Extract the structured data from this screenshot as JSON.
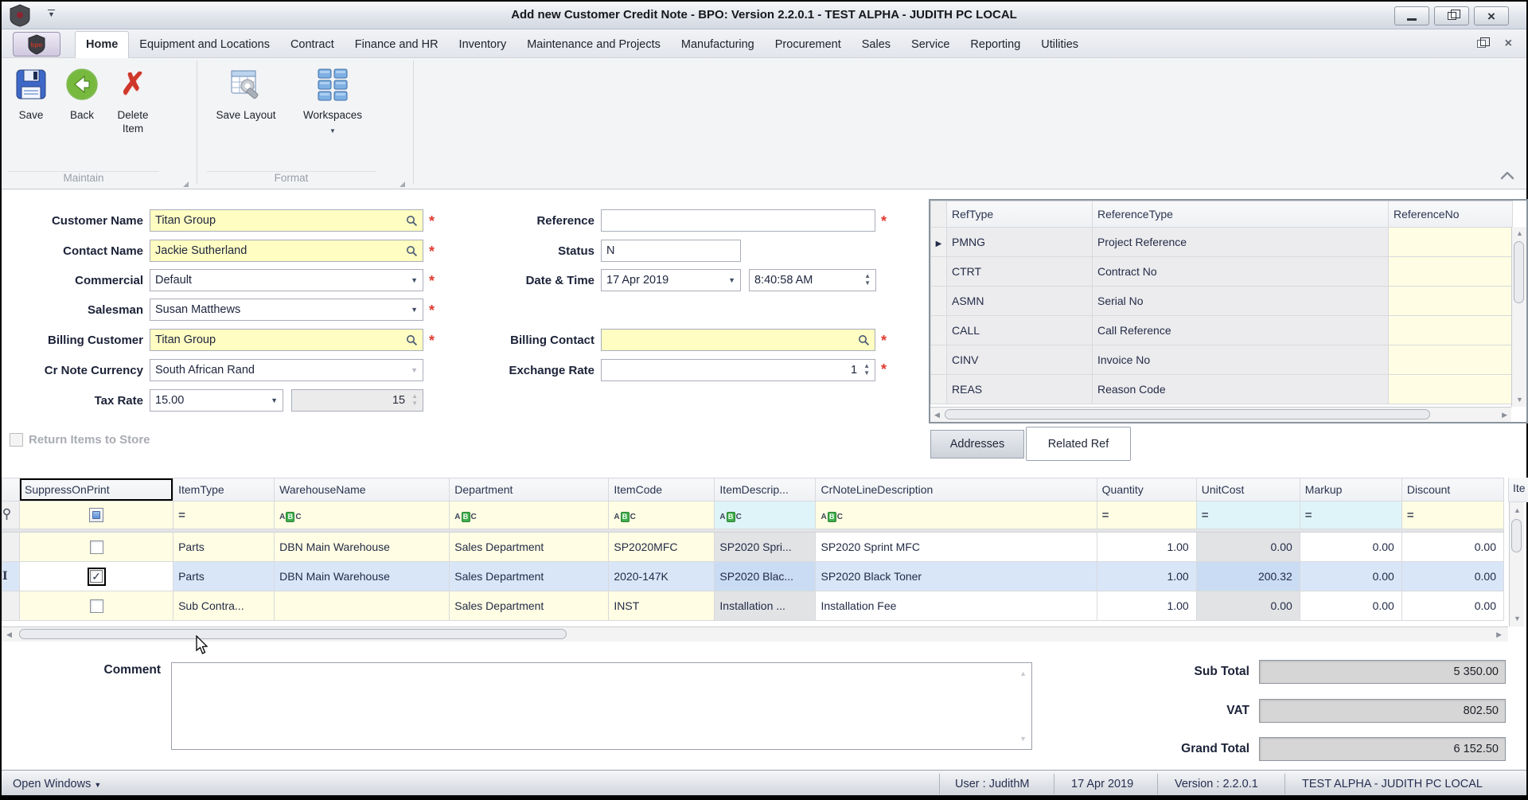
{
  "window": {
    "title": "Add new Customer Credit Note - BPO: Version 2.2.0.1 - TEST ALPHA - JUDITH PC LOCAL"
  },
  "ribbon": {
    "tabs": [
      "Home",
      "Equipment and Locations",
      "Contract",
      "Finance and HR",
      "Inventory",
      "Maintenance and Projects",
      "Manufacturing",
      "Procurement",
      "Sales",
      "Service",
      "Reporting",
      "Utilities"
    ],
    "active_tab": "Home",
    "buttons": {
      "save": "Save",
      "back": "Back",
      "delete_item_line1": "Delete",
      "delete_item_line2": "Item",
      "save_layout": "Save Layout",
      "workspaces": "Workspaces"
    },
    "groups": {
      "maintain": "Maintain",
      "format": "Format"
    }
  },
  "form": {
    "customer_name": {
      "label": "Customer Name",
      "value": "Titan Group"
    },
    "contact_name": {
      "label": "Contact Name",
      "value": "Jackie Sutherland"
    },
    "commercial": {
      "label": "Commercial",
      "value": "Default"
    },
    "salesman": {
      "label": "Salesman",
      "value": "Susan Matthews"
    },
    "billing_customer": {
      "label": "Billing Customer",
      "value": "Titan Group"
    },
    "cr_note_currency": {
      "label": "Cr Note Currency",
      "value": "South African Rand"
    },
    "tax_rate": {
      "label": "Tax Rate",
      "value": "15.00",
      "amount": "15"
    },
    "return_items": {
      "label": "Return Items to Store"
    },
    "reference": {
      "label": "Reference",
      "value": ""
    },
    "status": {
      "label": "Status",
      "value": "N"
    },
    "date_time": {
      "label": "Date & Time",
      "date": "17 Apr 2019",
      "time": "8:40:58 AM"
    },
    "billing_contact": {
      "label": "Billing Contact",
      "value": ""
    },
    "exchange_rate": {
      "label": "Exchange Rate",
      "value": "1"
    }
  },
  "ref_grid": {
    "columns": [
      "RefType",
      "ReferenceType",
      "ReferenceNo"
    ],
    "rows": [
      {
        "ref": "PMNG",
        "type": "Project Reference",
        "no": ""
      },
      {
        "ref": "CTRT",
        "type": "Contract No",
        "no": ""
      },
      {
        "ref": "ASMN",
        "type": "Serial No",
        "no": ""
      },
      {
        "ref": "CALL",
        "type": "Call Reference",
        "no": ""
      },
      {
        "ref": "CINV",
        "type": "Invoice No",
        "no": ""
      },
      {
        "ref": "REAS",
        "type": "Reason Code",
        "no": ""
      }
    ]
  },
  "panel_tabs": {
    "addresses": "Addresses",
    "related_ref": "Related Ref"
  },
  "items_grid": {
    "columns": [
      "SuppressOnPrint",
      "ItemType",
      "WarehouseName",
      "Department",
      "ItemCode",
      "ItemDescrip...",
      "CrNoteLineDescription",
      "Quantity",
      "UnitCost",
      "Markup",
      "Discount",
      "Ite"
    ],
    "rows": [
      {
        "checked": false,
        "cells": [
          "Parts",
          "DBN Main Warehouse",
          "Sales Department",
          "SP2020MFC",
          "SP2020 Spri...",
          "SP2020 Sprint MFC",
          "1.00",
          "0.00",
          "0.00",
          "0.00"
        ]
      },
      {
        "checked": true,
        "cells": [
          "Parts",
          "DBN Main Warehouse",
          "Sales Department",
          "2020-147K",
          "SP2020 Blac...",
          "SP2020 Black Toner",
          "1.00",
          "200.32",
          "0.00",
          "0.00"
        ]
      },
      {
        "checked": false,
        "cells": [
          "Sub Contra...",
          "",
          "Sales Department",
          "INST",
          "Installation ...",
          "Installation Fee",
          "1.00",
          "0.00",
          "0.00",
          "0.00"
        ]
      }
    ]
  },
  "comment": {
    "label": "Comment",
    "value": ""
  },
  "totals": {
    "sub_total": {
      "label": "Sub Total",
      "value": "5 350.00"
    },
    "vat": {
      "label": "VAT",
      "value": "802.50"
    },
    "grand_total": {
      "label": "Grand Total",
      "value": "6 152.50"
    }
  },
  "statusbar": {
    "open_windows": "Open Windows",
    "user": "User : JudithM",
    "date": "17 Apr 2019",
    "version": "Version : 2.2.0.1",
    "environment": "TEST ALPHA - JUDITH PC LOCAL"
  },
  "icons": {
    "abc_a": "A",
    "abc_b": "B",
    "abc_c": "C",
    "equals": "=",
    "check": "✓",
    "arrow_down": "▼",
    "arrow_up": "▲",
    "arrow_left": "◀",
    "arrow_right": "▶",
    "row_edit": "I"
  },
  "colors": {
    "required_bg": "#fffdc2",
    "filter_cream": "#fffde3",
    "filter_cyan": "#dff4f9",
    "selected_row": "#d9e6f8",
    "readonly_gray": "#e2e3e5",
    "total_bg": "#d6d6d6",
    "asterisk_red": "#e03a2f"
  }
}
